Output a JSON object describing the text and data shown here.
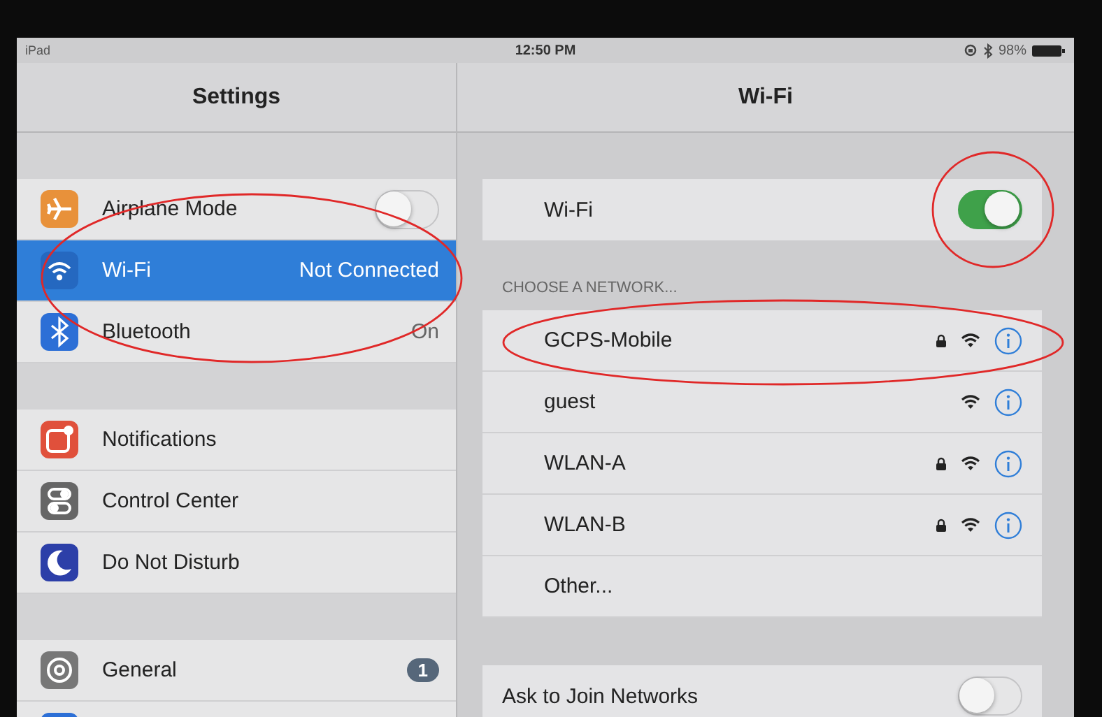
{
  "status_bar": {
    "device": "iPad",
    "time": "12:50 PM",
    "battery": "98%"
  },
  "sidebar": {
    "title": "Settings",
    "groups": [
      [
        {
          "label": "Airplane Mode",
          "kind": "toggle",
          "on": false,
          "selected": false,
          "color": "#e8913a"
        },
        {
          "label": "Wi-Fi",
          "kind": "detail",
          "value": "Not Connected",
          "selected": true,
          "color": "#2568c0"
        },
        {
          "label": "Bluetooth",
          "kind": "detail",
          "value": "On",
          "selected": false,
          "color": "#2c6fd6"
        }
      ],
      [
        {
          "label": "Notifications",
          "kind": "plain",
          "selected": false,
          "color": "#e0503b"
        },
        {
          "label": "Control Center",
          "kind": "plain",
          "selected": false,
          "color": "#666666"
        },
        {
          "label": "Do Not Disturb",
          "kind": "plain",
          "selected": false,
          "color": "#2c3fa8"
        }
      ],
      [
        {
          "label": "General",
          "kind": "badge",
          "badge": "1",
          "selected": false,
          "color": "#777777"
        },
        {
          "kind": "plain",
          "selected": false,
          "color": "#2c6fd6"
        }
      ]
    ]
  },
  "detail": {
    "title": "Wi-Fi",
    "wifi_row": {
      "label": "Wi-Fi",
      "on": true
    },
    "section_header": "CHOOSE A NETWORK...",
    "networks": [
      {
        "name": "GCPS-Mobile",
        "kind": "network",
        "secured": true
      },
      {
        "name": "guest",
        "kind": "network",
        "secured": false
      },
      {
        "name": "WLAN-A",
        "kind": "network",
        "secured": true
      },
      {
        "name": "WLAN-B",
        "kind": "network",
        "secured": true
      },
      {
        "name": "Other...",
        "kind": "other"
      }
    ],
    "ask_row": {
      "label": "Ask to Join Networks",
      "on": false
    }
  }
}
